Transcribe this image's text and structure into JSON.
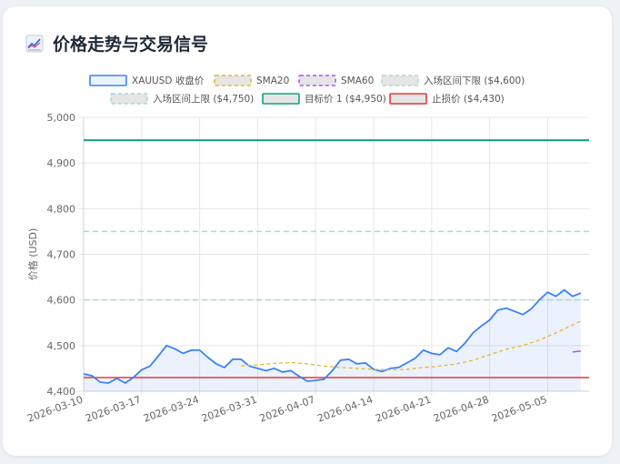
{
  "title": "价格走势与交易信号",
  "colors": {
    "price": "#3b82f6",
    "price_fill": "rgba(59,130,246,0.10)",
    "sma20": "#e5b82e",
    "sma60": "#a855f7",
    "entry": "#a7dcc9",
    "target": "#10a37f",
    "stop": "#e53935"
  },
  "chart_data": {
    "type": "line",
    "ylabel": "价格 (USD)",
    "ylim": [
      4400,
      5000
    ],
    "y_ticks": [
      "5,000",
      "4,900",
      "4,800",
      "4,700",
      "4,600",
      "4,500",
      "4,400"
    ],
    "x_tick_labels": [
      "2026-03-10",
      "2026-03-17",
      "2026-03-24",
      "2026-03-31",
      "2026-04-07",
      "2026-04-14",
      "2026-04-21",
      "2026-04-28",
      "2026-05-05"
    ],
    "x_range": [
      "2026-03-10",
      "2026-05-10"
    ],
    "legend": [
      {
        "label": "XAUUSD 收盘价",
        "style": "solid-fill",
        "color_key": "price"
      },
      {
        "label": "SMA20",
        "style": "dashed",
        "color_key": "sma20"
      },
      {
        "label": "SMA60",
        "style": "dashed",
        "color_key": "sma60"
      },
      {
        "label": "入场区间下限 ($4,600)",
        "style": "dashed",
        "color_key": "entry"
      },
      {
        "label": "入场区间上限 ($4,750)",
        "style": "dashed",
        "color_key": "entry"
      },
      {
        "label": "目标价 1 ($4,950)",
        "style": "solid",
        "color_key": "target"
      },
      {
        "label": "止损价 ($4,430)",
        "style": "solid",
        "color_key": "stop"
      }
    ],
    "series": [
      {
        "name": "XAUUSD 收盘价",
        "points": [
          [
            "2026-03-10",
            4438
          ],
          [
            "2026-03-11",
            4434
          ],
          [
            "2026-03-12",
            4420
          ],
          [
            "2026-03-13",
            4418
          ],
          [
            "2026-03-14",
            4428
          ],
          [
            "2026-03-15",
            4418
          ],
          [
            "2026-03-16",
            4430
          ],
          [
            "2026-03-17",
            4447
          ],
          [
            "2026-03-18",
            4455
          ],
          [
            "2026-03-19",
            4477
          ],
          [
            "2026-03-20",
            4500
          ],
          [
            "2026-03-21",
            4493
          ],
          [
            "2026-03-22",
            4483
          ],
          [
            "2026-03-23",
            4490
          ],
          [
            "2026-03-24",
            4490
          ],
          [
            "2026-03-25",
            4474
          ],
          [
            "2026-03-26",
            4460
          ],
          [
            "2026-03-27",
            4452
          ],
          [
            "2026-03-28",
            4470
          ],
          [
            "2026-03-29",
            4470
          ],
          [
            "2026-03-30",
            4455
          ],
          [
            "2026-03-31",
            4450
          ],
          [
            "2026-04-01",
            4445
          ],
          [
            "2026-04-02",
            4450
          ],
          [
            "2026-04-03",
            4442
          ],
          [
            "2026-04-04",
            4445
          ],
          [
            "2026-04-05",
            4433
          ],
          [
            "2026-04-06",
            4422
          ],
          [
            "2026-04-07",
            4424
          ],
          [
            "2026-04-08",
            4426
          ],
          [
            "2026-04-09",
            4445
          ],
          [
            "2026-04-10",
            4468
          ],
          [
            "2026-04-11",
            4470
          ],
          [
            "2026-04-12",
            4460
          ],
          [
            "2026-04-13",
            4462
          ],
          [
            "2026-04-14",
            4448
          ],
          [
            "2026-04-15",
            4443
          ],
          [
            "2026-04-16",
            4450
          ],
          [
            "2026-04-17",
            4452
          ],
          [
            "2026-04-18",
            4462
          ],
          [
            "2026-04-19",
            4472
          ],
          [
            "2026-04-20",
            4490
          ],
          [
            "2026-04-21",
            4483
          ],
          [
            "2026-04-22",
            4480
          ],
          [
            "2026-04-23",
            4495
          ],
          [
            "2026-04-24",
            4487
          ],
          [
            "2026-04-25",
            4505
          ],
          [
            "2026-04-26",
            4528
          ],
          [
            "2026-04-27",
            4543
          ],
          [
            "2026-04-28",
            4556
          ],
          [
            "2026-04-29",
            4578
          ],
          [
            "2026-04-30",
            4582
          ],
          [
            "2026-05-01",
            4575
          ],
          [
            "2026-05-02",
            4568
          ],
          [
            "2026-05-03",
            4580
          ],
          [
            "2026-05-04",
            4600
          ],
          [
            "2026-05-05",
            4617
          ],
          [
            "2026-05-06",
            4608
          ],
          [
            "2026-05-07",
            4622
          ],
          [
            "2026-05-08",
            4608
          ],
          [
            "2026-05-09",
            4615
          ]
        ]
      },
      {
        "name": "SMA20",
        "points": [
          [
            "2026-03-29",
            4455
          ],
          [
            "2026-03-31",
            4458
          ],
          [
            "2026-04-02",
            4461
          ],
          [
            "2026-04-04",
            4463
          ],
          [
            "2026-04-06",
            4460
          ],
          [
            "2026-04-08",
            4455
          ],
          [
            "2026-04-10",
            4452
          ],
          [
            "2026-04-12",
            4450
          ],
          [
            "2026-04-14",
            4448
          ],
          [
            "2026-04-16",
            4447
          ],
          [
            "2026-04-18",
            4448
          ],
          [
            "2026-04-20",
            4452
          ],
          [
            "2026-04-22",
            4455
          ],
          [
            "2026-04-24",
            4460
          ],
          [
            "2026-04-26",
            4468
          ],
          [
            "2026-04-28",
            4480
          ],
          [
            "2026-04-30",
            4492
          ],
          [
            "2026-05-02",
            4500
          ],
          [
            "2026-05-04",
            4512
          ],
          [
            "2026-05-06",
            4528
          ],
          [
            "2026-05-08",
            4545
          ],
          [
            "2026-05-09",
            4554
          ]
        ]
      },
      {
        "name": "SMA60",
        "points": [
          [
            "2026-05-08",
            4486
          ],
          [
            "2026-05-09",
            4488
          ]
        ]
      }
    ],
    "reference_lines": [
      {
        "label": "入场区间下限 ($4,600)",
        "value": 4600
      },
      {
        "label": "入场区间上限 ($4,750)",
        "value": 4750
      },
      {
        "label": "目标价 1 ($4,950)",
        "value": 4950
      },
      {
        "label": "止损价 ($4,430)",
        "value": 4430
      }
    ],
    "grid": true,
    "legend_position": "top"
  }
}
